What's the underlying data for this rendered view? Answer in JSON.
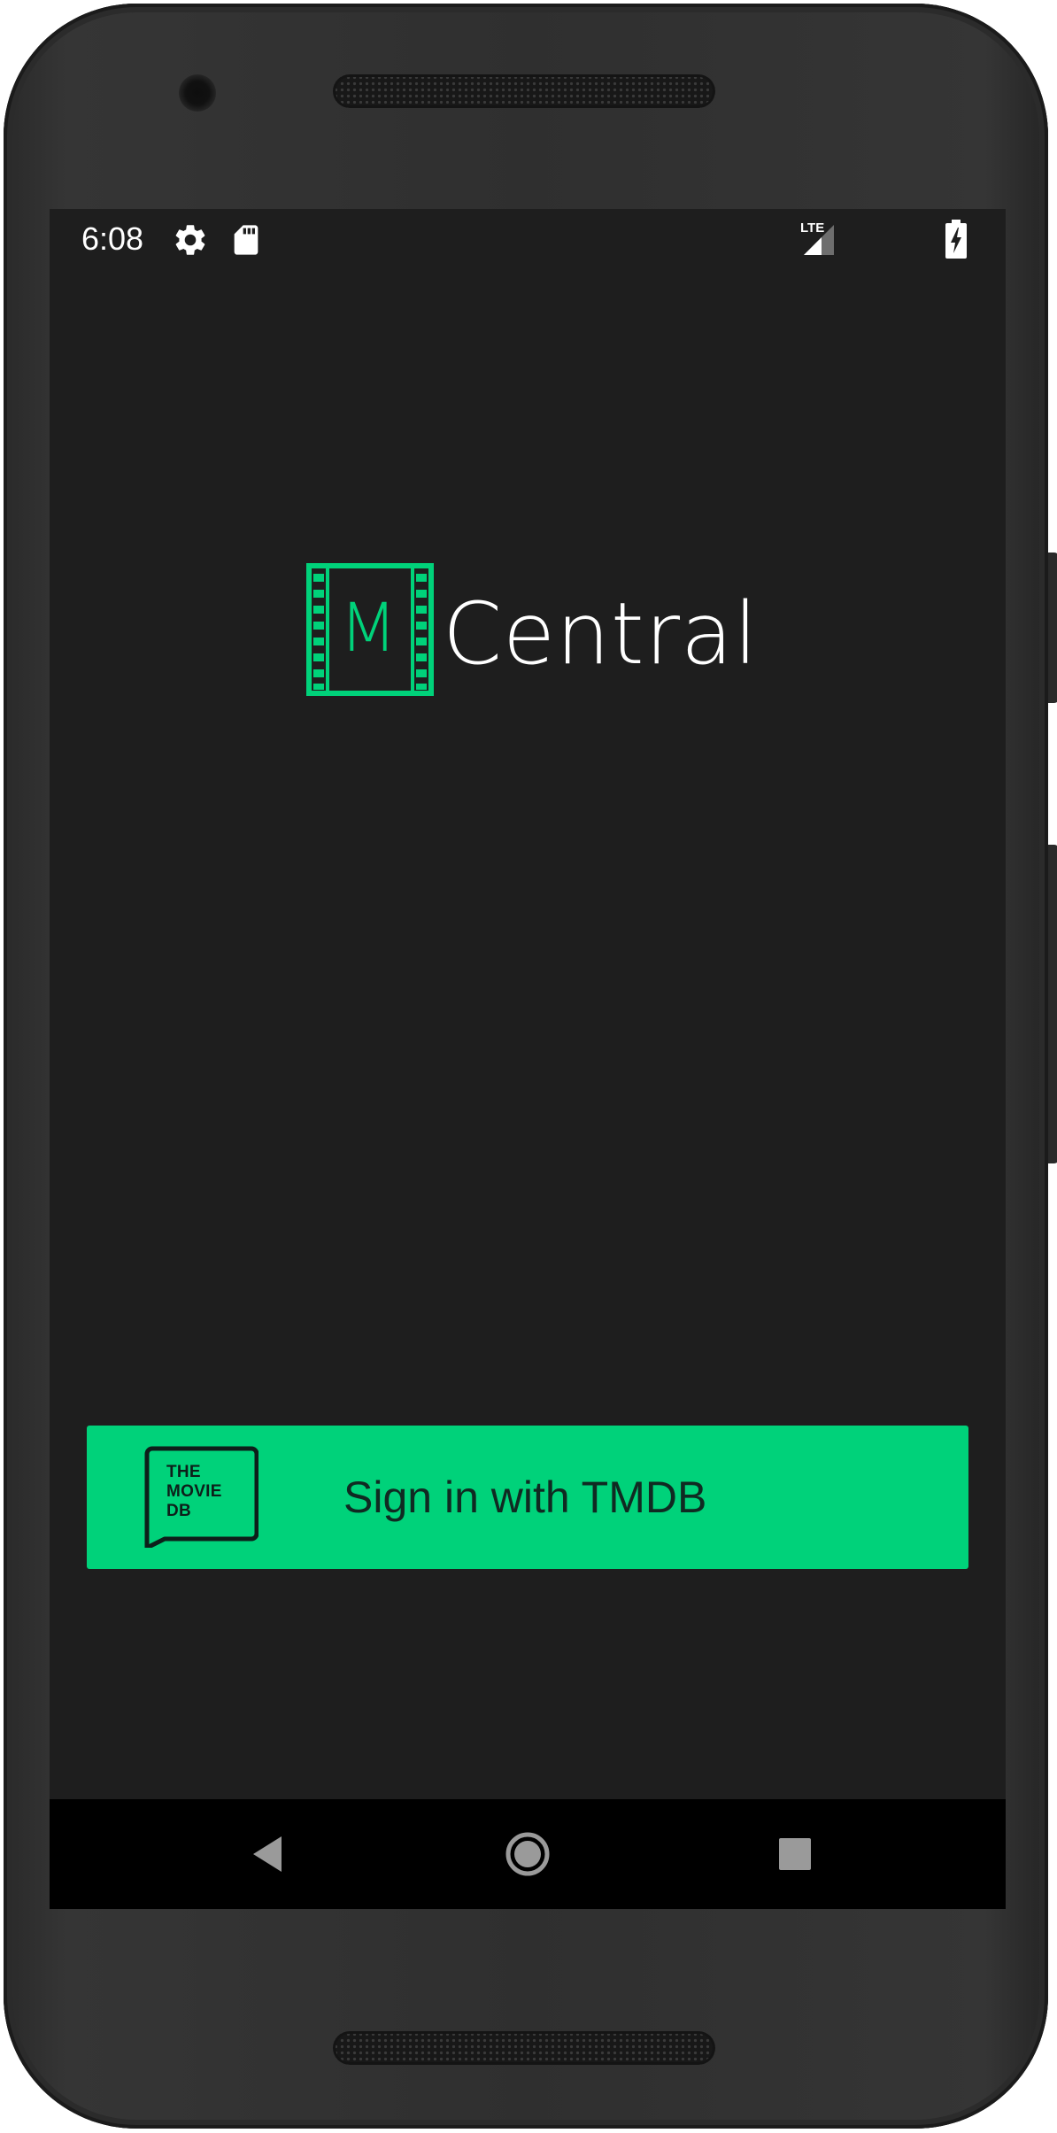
{
  "status_bar": {
    "time": "6:08",
    "left_icons": [
      "settings-gear-icon",
      "sd-card-icon"
    ],
    "network_type": "LTE",
    "right_icons": [
      "lte-signal-icon",
      "battery-charging-icon"
    ]
  },
  "logo": {
    "monogram": "M",
    "wordmark": "Central",
    "accent_color": "#00d27a"
  },
  "signin": {
    "label": "Sign in with TMDB",
    "badge_lines": [
      "THE",
      "MOVIE",
      "DB"
    ],
    "button_color": "#00d27a"
  },
  "nav_bar": {
    "buttons": [
      "back",
      "home",
      "recents"
    ]
  },
  "theme": {
    "background": "#1e1e1e",
    "device_body": "#2f2f2f"
  }
}
